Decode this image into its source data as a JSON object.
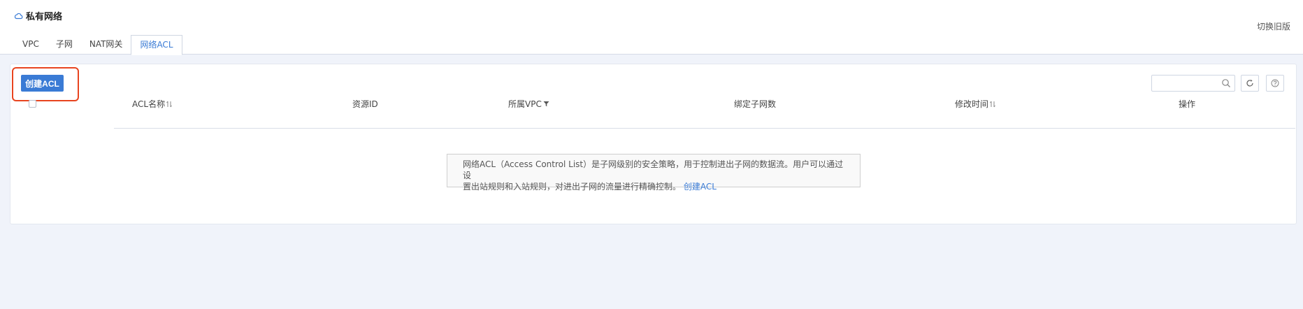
{
  "header": {
    "title": "私有网络",
    "switch_old": "切换旧版"
  },
  "tabs": [
    {
      "label": "VPC",
      "active": false
    },
    {
      "label": "子网",
      "active": false
    },
    {
      "label": "NAT网关",
      "active": false
    },
    {
      "label": "网络ACL",
      "active": true
    }
  ],
  "toolbar": {
    "create_label": "创建ACL",
    "search_placeholder": ""
  },
  "table": {
    "columns": [
      {
        "label": "ACL名称",
        "sortable": true
      },
      {
        "label": "资源ID",
        "sortable": false
      },
      {
        "label": "所属VPC",
        "filterable": true
      },
      {
        "label": "绑定子网数",
        "sortable": false
      },
      {
        "label": "修改时间",
        "sortable": true
      },
      {
        "label": "操作",
        "sortable": false
      }
    ],
    "rows": []
  },
  "empty": {
    "line1": "网络ACL（Access Control List）是子网级别的安全策略，用于控制进出子网的数据流。用户可以通过设",
    "line2": "置出站规则和入站规则，对进出子网的流量进行精确控制。",
    "link": "创建ACL"
  },
  "colors": {
    "accent": "#3a7bd5",
    "highlight": "#e8441f",
    "background": "#f0f3fa"
  }
}
